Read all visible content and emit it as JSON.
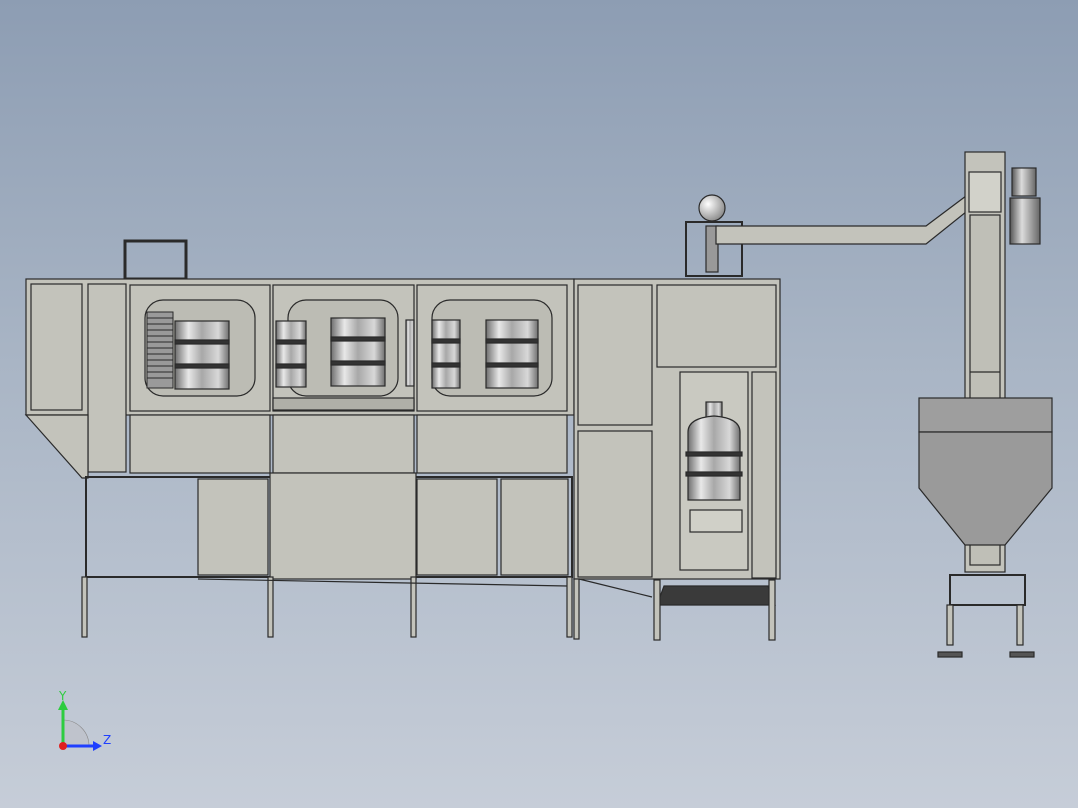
{
  "viewport": {
    "background_top": "#8d9db3",
    "background_bottom": "#c6cdd8"
  },
  "model": {
    "frame_color": "#c3c3bb",
    "outline_color": "#2a2a2a",
    "bottle_color": "#bfbfbf",
    "dark_tray_color": "#3a3a3a"
  },
  "triad": {
    "y_label": "Y",
    "z_label": "Z",
    "y_color": "#2ecc40",
    "z_color": "#1f3fff",
    "x_color": "#e02020"
  }
}
